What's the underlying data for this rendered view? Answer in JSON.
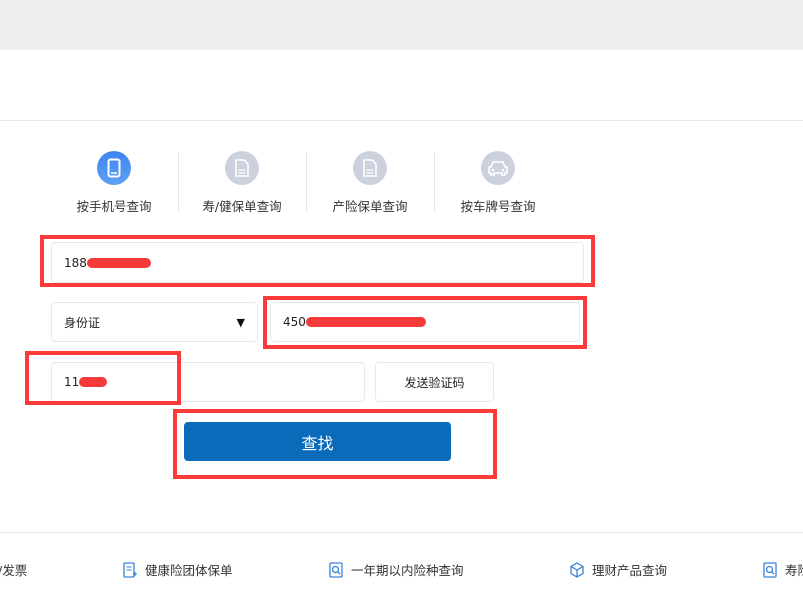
{
  "tabs": [
    {
      "label": "按手机号查询",
      "icon": "phone-icon",
      "active": true
    },
    {
      "label": "寿/健保单查询",
      "icon": "document-icon",
      "active": false
    },
    {
      "label": "产险保单查询",
      "icon": "document-icon",
      "active": false
    },
    {
      "label": "按车牌号查询",
      "icon": "car-icon",
      "active": false
    }
  ],
  "form": {
    "phone_value": "188",
    "id_type": "身份证",
    "id_value": "450",
    "code_value": "11",
    "send_code_label": "发送验证码",
    "search_label": "查找"
  },
  "bottom_links": [
    {
      "label": "/发票"
    },
    {
      "label": "健康险团体保单",
      "icon": "list-document-icon"
    },
    {
      "label": "一年期以内险种查询",
      "icon": "search-document-icon"
    },
    {
      "label": "理财产品查询",
      "icon": "cube-icon"
    },
    {
      "label": "寿险",
      "icon": "search-document-icon"
    }
  ],
  "colors": {
    "accent": "#0a6bba",
    "active_icon": "#4a90f0",
    "inactive_icon": "#c9d0dc",
    "annotation": "#fc3a3a"
  }
}
